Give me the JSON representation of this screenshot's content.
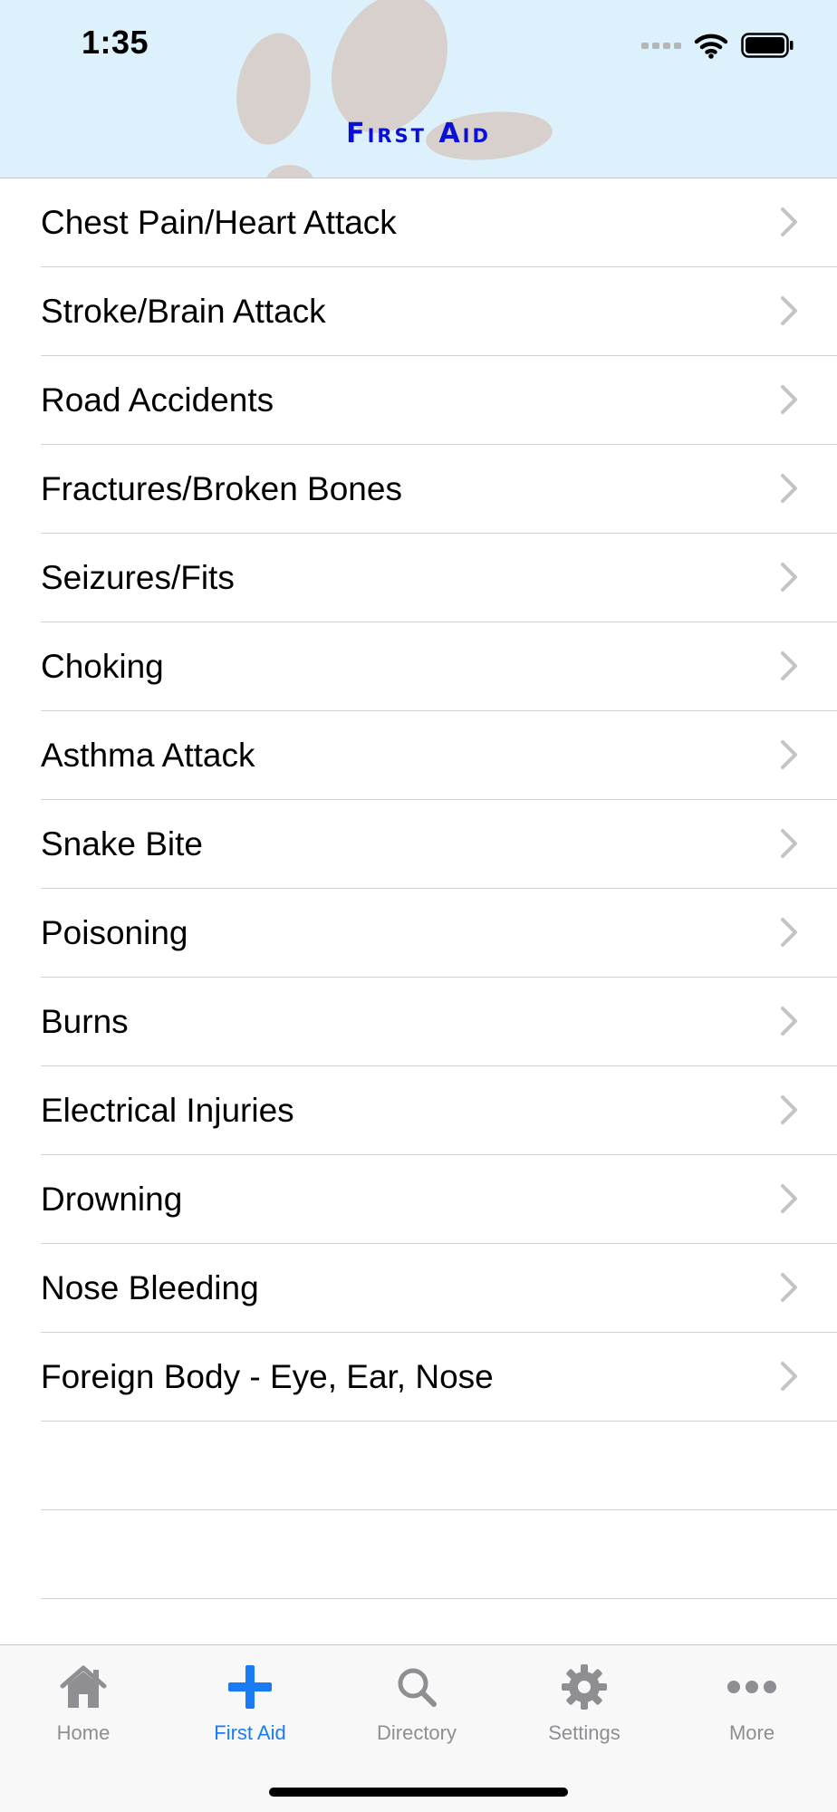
{
  "status_bar": {
    "time": "1:35"
  },
  "nav": {
    "title": "First Aid",
    "title_color": "#0a10d8"
  },
  "list": {
    "items": [
      {
        "label": "Chest Pain/Heart Attack"
      },
      {
        "label": "Stroke/Brain Attack"
      },
      {
        "label": "Road Accidents"
      },
      {
        "label": "Fractures/Broken Bones"
      },
      {
        "label": "Seizures/Fits"
      },
      {
        "label": "Choking"
      },
      {
        "label": "Asthma Attack"
      },
      {
        "label": "Snake Bite"
      },
      {
        "label": "Poisoning"
      },
      {
        "label": "Burns"
      },
      {
        "label": "Electrical Injuries"
      },
      {
        "label": "Drowning"
      },
      {
        "label": "Nose Bleeding"
      },
      {
        "label": "Foreign Body - Eye, Ear, Nose"
      }
    ]
  },
  "tabbar": {
    "active_color": "#1a7cf5",
    "inactive_color": "#8e8e93",
    "tabs": [
      {
        "label": "Home",
        "icon": "home-icon",
        "active": false
      },
      {
        "label": "First Aid",
        "icon": "plus-icon",
        "active": true
      },
      {
        "label": "Directory",
        "icon": "search-icon",
        "active": false
      },
      {
        "label": "Settings",
        "icon": "gear-icon",
        "active": false
      },
      {
        "label": "More",
        "icon": "more-icon",
        "active": false
      }
    ]
  }
}
